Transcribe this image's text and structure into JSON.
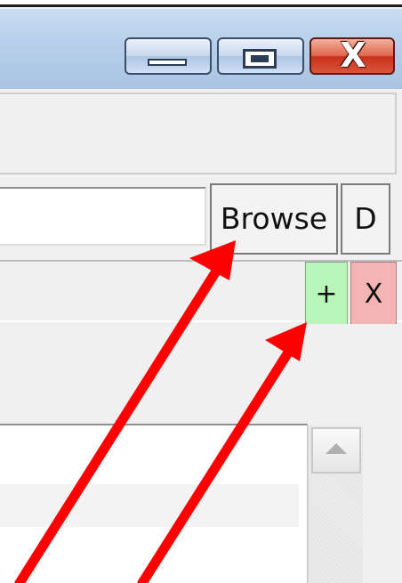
{
  "window": {
    "controls": {
      "minimize_icon": "minimize-icon",
      "maximize_icon": "maximize-icon",
      "close_label": "X"
    }
  },
  "path_row": {
    "input_value": "",
    "browse_label": "Browse",
    "d_label": "D"
  },
  "list_toolbar": {
    "add_label": "+",
    "remove_label": "X",
    "add_color": "#b8f5b8",
    "remove_color": "#f3b4b4"
  },
  "annotations": {
    "arrow_color": "#ff0000"
  }
}
